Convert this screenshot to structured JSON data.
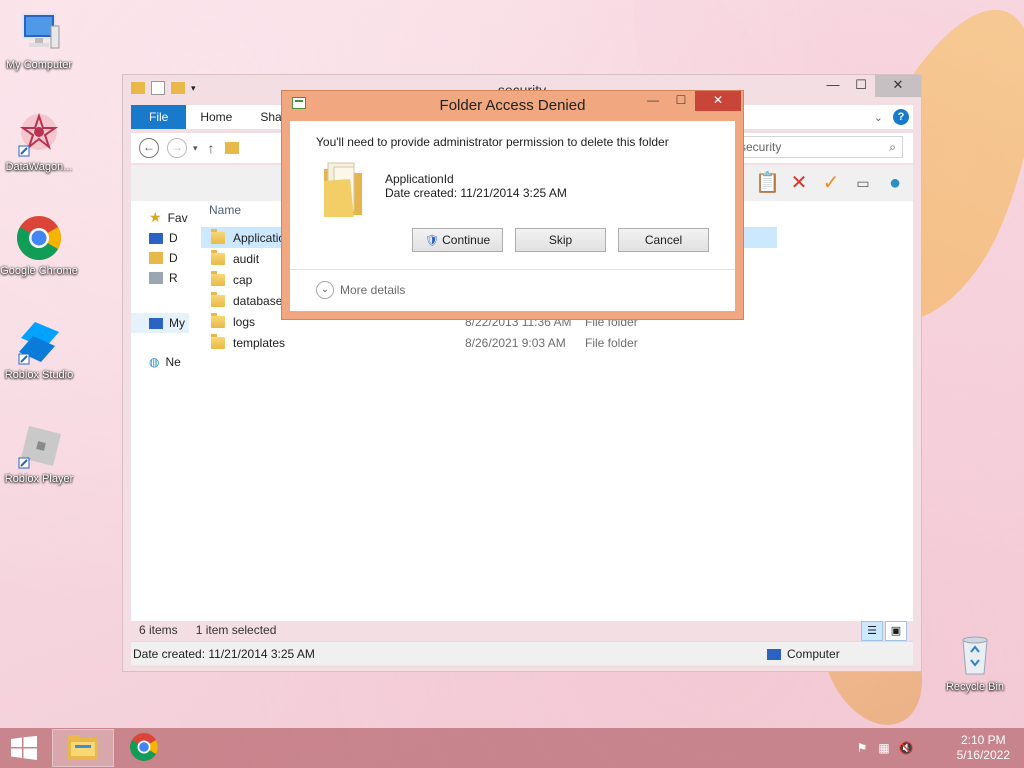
{
  "desktop": {
    "icons": [
      {
        "label": "My Computer"
      },
      {
        "label": "DataWagon..."
      },
      {
        "label": "Google Chrome"
      },
      {
        "label": "Roblox Studio"
      },
      {
        "label": "Roblox Player"
      },
      {
        "label": "Recycle Bin"
      }
    ]
  },
  "explorer": {
    "title": "security",
    "tabs": {
      "file": "File",
      "home": "Home",
      "share": "Shar"
    },
    "address": {
      "search_placeholder": "security"
    },
    "nav": {
      "favorites": "Fav",
      "item_d1": "D",
      "item_d2": "D",
      "item_r": "R",
      "my_computer": "My",
      "network": "Ne"
    },
    "columns": {
      "name": "Name"
    },
    "files": [
      {
        "name": "Application",
        "date": "",
        "type": ""
      },
      {
        "name": "audit",
        "date": "",
        "type": ""
      },
      {
        "name": "cap",
        "date": "",
        "type": ""
      },
      {
        "name": "database",
        "date": "",
        "type": ""
      },
      {
        "name": "logs",
        "date": "8/22/2013 11:36 AM",
        "type": "File folder"
      },
      {
        "name": "templates",
        "date": "8/26/2021 9:03 AM",
        "type": "File folder"
      }
    ],
    "status": {
      "item_count": "6 items",
      "selected": "1 item selected",
      "details": "Date created: 11/21/2014 3:25 AM",
      "location": "Computer"
    }
  },
  "dialog": {
    "title": "Folder Access Denied",
    "message": "You'll need to provide administrator permission to delete this folder",
    "folder_name": "ApplicationId",
    "folder_date": "Date created: 11/21/2014 3:25 AM",
    "buttons": {
      "continue": "Continue",
      "skip": "Skip",
      "cancel": "Cancel"
    },
    "more_details": "More details"
  },
  "taskbar": {
    "time": "2:10 PM",
    "date": "5/16/2022"
  },
  "colors": {
    "accent": "#1979ca",
    "dialog_frame": "#f1a77f",
    "close_red": "#c9453a",
    "taskbar": "#c47e86"
  }
}
